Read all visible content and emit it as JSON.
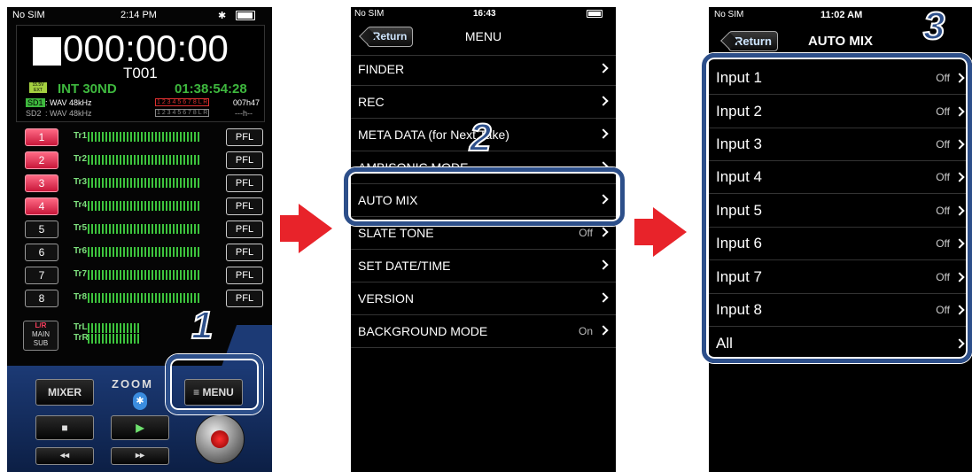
{
  "screen1": {
    "status": {
      "carrier": "No SIM",
      "time": "2:14 PM"
    },
    "timecode": "000:00:00",
    "take": "T001",
    "battery_badge": "15.5V EXT",
    "power_source": "INT 30ND",
    "remaining_time": "01:38:54:28",
    "sd1": {
      "label": "SD1",
      "format": ": WAV 48kHz",
      "remaining": "007h47"
    },
    "sd2": {
      "label": "SD2",
      "format": ": WAV 48kHz",
      "remaining": "---h--"
    },
    "channel_boxes": "1 2 3 4 5 6 7 8 L R",
    "tracks": [
      {
        "num": "1",
        "label": "Tr1",
        "pfl": "PFL"
      },
      {
        "num": "2",
        "label": "Tr2",
        "pfl": "PFL"
      },
      {
        "num": "3",
        "label": "Tr3",
        "pfl": "PFL"
      },
      {
        "num": "4",
        "label": "Tr4",
        "pfl": "PFL"
      },
      {
        "num": "5",
        "label": "Tr5",
        "pfl": "PFL"
      },
      {
        "num": "6",
        "label": "Tr6",
        "pfl": "PFL"
      },
      {
        "num": "7",
        "label": "Tr7",
        "pfl": "PFL"
      },
      {
        "num": "8",
        "label": "Tr8",
        "pfl": "PFL"
      }
    ],
    "main_sub": {
      "top": "L/R",
      "mid": "MAIN",
      "bot": "SUB",
      "trl": "TrL",
      "trr": "TrR"
    },
    "mixer_button": "MIXER",
    "menu_button": "≡ MENU",
    "brand": "ZOOM",
    "stop_glyph": "■",
    "play_glyph": "▶",
    "rew_glyph": "◂◂",
    "ff_glyph": "▸▸",
    "step_number": "1"
  },
  "screen2": {
    "status": {
      "carrier": "No SIM",
      "time": "16:43"
    },
    "return_label": "Return",
    "title": "MENU",
    "items": [
      {
        "label": "FINDER",
        "value": ""
      },
      {
        "label": "REC",
        "value": ""
      },
      {
        "label": "META DATA (for Next Take)",
        "value": ""
      },
      {
        "label": "AMBISONIC MODE",
        "value": ""
      },
      {
        "label": "AUTO MIX",
        "value": ""
      },
      {
        "label": "SLATE TONE",
        "value": "Off"
      },
      {
        "label": "SET DATE/TIME",
        "value": ""
      },
      {
        "label": "VERSION",
        "value": ""
      },
      {
        "label": "BACKGROUND MODE",
        "value": "On"
      }
    ],
    "step_number": "2"
  },
  "screen3": {
    "status": {
      "carrier": "No SIM",
      "time": "11:02 AM"
    },
    "return_label": "Return",
    "title": "AUTO MIX",
    "items": [
      {
        "label": "Input 1",
        "value": "Off"
      },
      {
        "label": "Input 2",
        "value": "Off"
      },
      {
        "label": "Input 3",
        "value": "Off"
      },
      {
        "label": "Input 4",
        "value": "Off"
      },
      {
        "label": "Input 5",
        "value": "Off"
      },
      {
        "label": "Input 6",
        "value": "Off"
      },
      {
        "label": "Input 7",
        "value": "Off"
      },
      {
        "label": "Input 8",
        "value": "Off"
      },
      {
        "label": "All",
        "value": ""
      }
    ],
    "step_number": "3"
  },
  "colors": {
    "highlight": "#2d4f8a",
    "arrow": "#e8232a",
    "track_red": "#d11e45",
    "meter_green": "#3ec43e"
  }
}
